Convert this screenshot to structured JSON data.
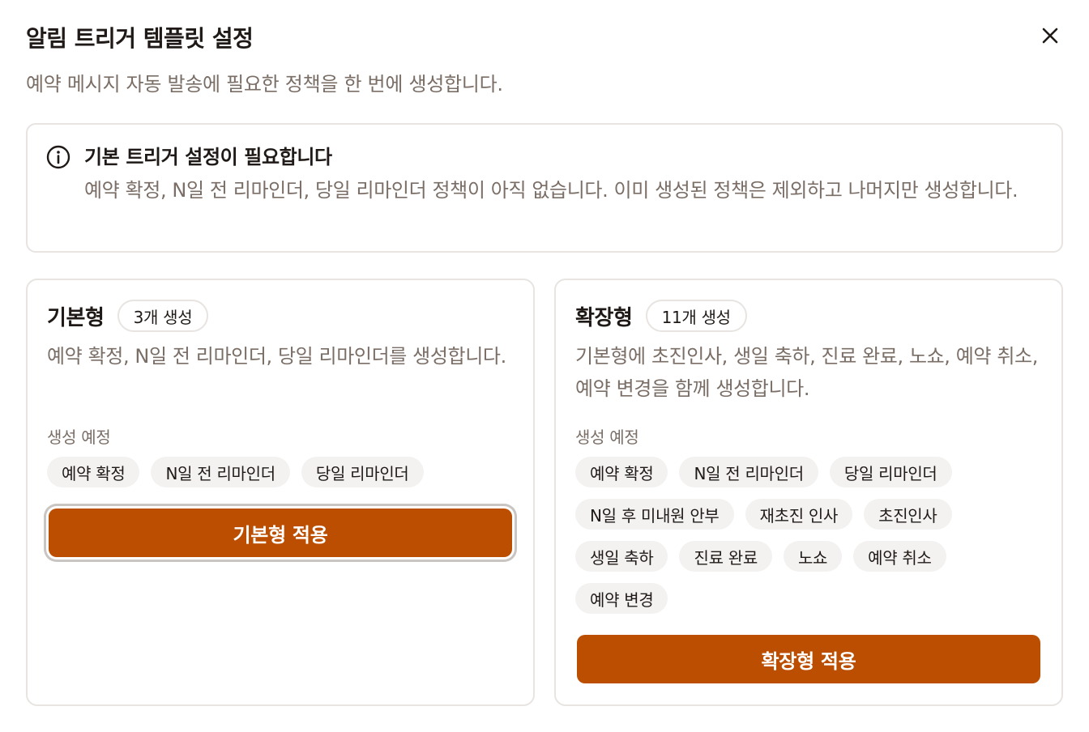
{
  "dialog": {
    "title": "알림 트리거 템플릿 설정",
    "subtitle": "예약 메시지 자동 발송에 필요한 정책을 한 번에 생성합니다.",
    "close_icon": "close-icon"
  },
  "alert": {
    "icon": "info-icon",
    "title": "기본 트리거 설정이 필요합니다",
    "description": "예약 확정, N일 전 리마인더, 당일 리마인더 정책이 아직 없습니다. 이미 생성된 정책은 제외하고 나머지만 생성합니다."
  },
  "basic": {
    "name": "기본형",
    "count": "3개 생성",
    "description": "예약 확정, N일 전 리마인더, 당일 리마인더를 생성합니다.",
    "section_label": "생성 예정",
    "chips": [
      "예약 확정",
      "N일 전 리마인더",
      "당일 리마인더"
    ],
    "apply_label": "기본형 적용"
  },
  "extended": {
    "name": "확장형",
    "count": "11개 생성",
    "description": "기본형에 초진인사, 생일 축하, 진료 완료, 노쇼, 예약 취소, 예약 변경을 함께 생성합니다.",
    "section_label": "생성 예정",
    "chips": [
      "예약 확정",
      "N일 전 리마인더",
      "당일 리마인더",
      "N일 후 미내원 안부",
      "재초진 인사",
      "초진인사",
      "생일 축하",
      "진료 완료",
      "노쇼",
      "예약 취소",
      "예약 변경"
    ],
    "apply_label": "확장형 적용"
  },
  "colors": {
    "accent": "#bb4e00",
    "muted_text": "#7a6e66",
    "border": "#e7e4e1",
    "chip_bg": "#f3f2f1"
  }
}
